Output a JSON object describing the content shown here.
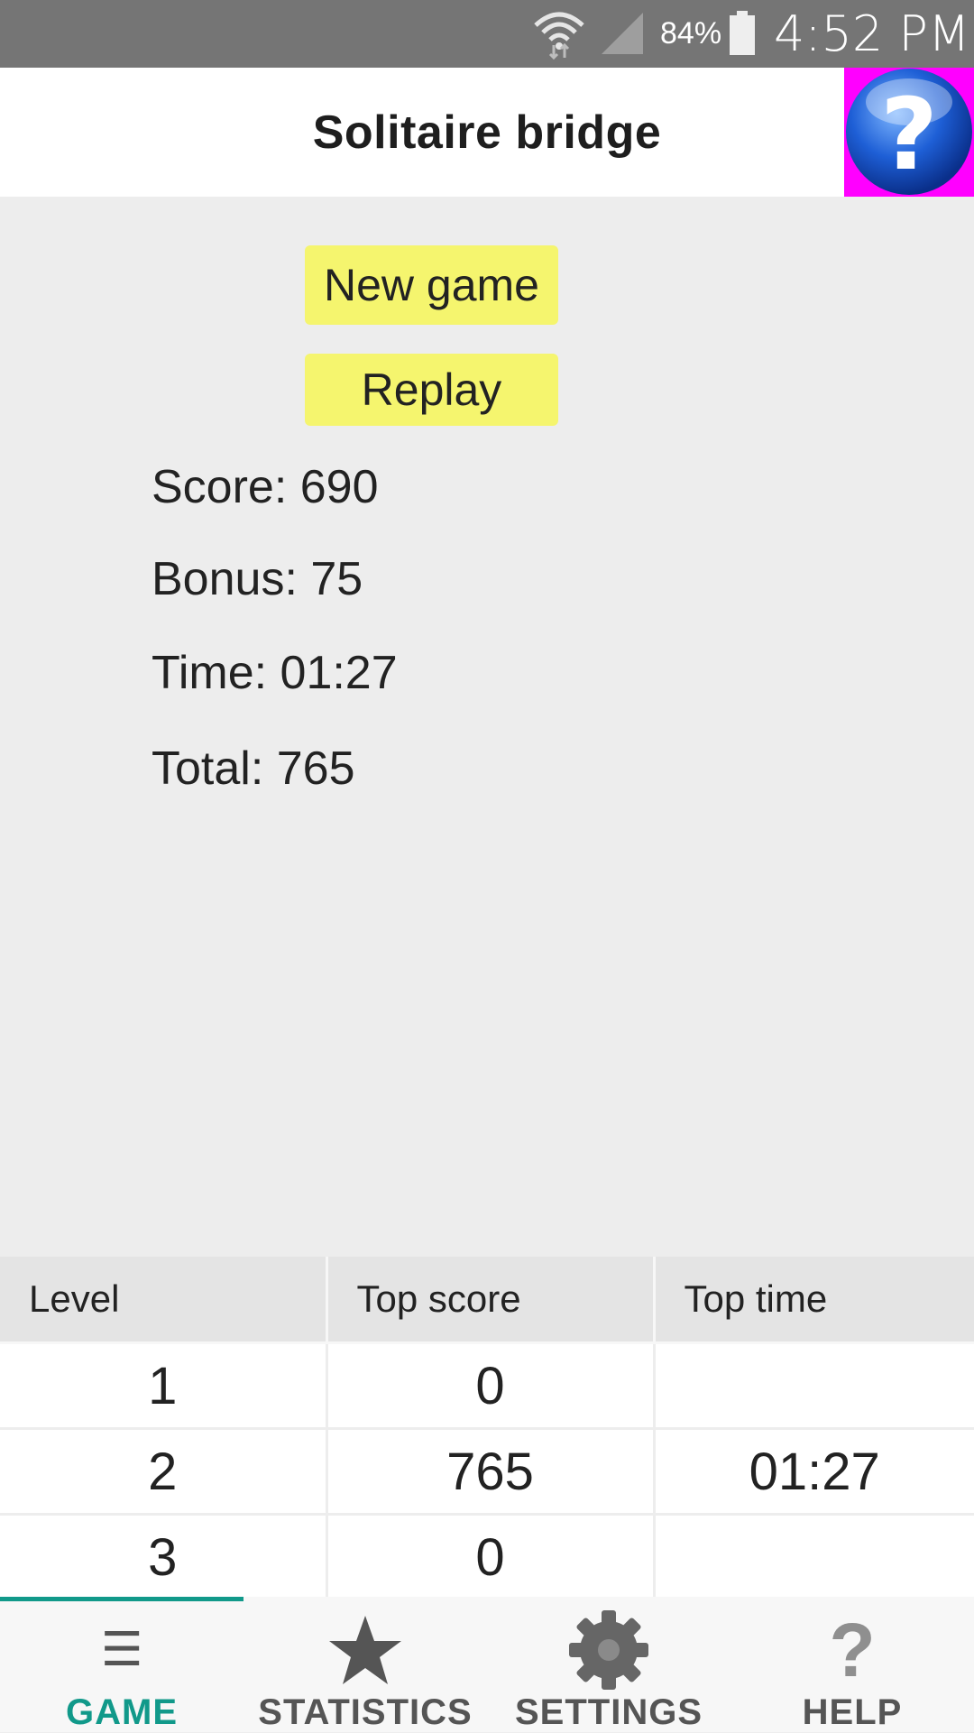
{
  "status_bar": {
    "battery_percent": "84%",
    "time": "4:52 PM"
  },
  "header": {
    "title": "Solitaire bridge",
    "help_icon": "question-icon",
    "help_icon_bg": "#ff00ff"
  },
  "actions": {
    "new_game_label": "New game",
    "replay_label": "Replay",
    "button_color": "#f5f56e"
  },
  "stats": {
    "score": "Score: 690",
    "bonus": "Bonus: 75",
    "time": "Time: 01:27",
    "total": "Total: 765"
  },
  "records": {
    "headers": [
      "Level",
      "Top score",
      "Top time"
    ],
    "rows": [
      [
        "1",
        "0",
        ""
      ],
      [
        "2",
        "765",
        "01:27"
      ],
      [
        "3",
        "0",
        ""
      ]
    ]
  },
  "bottom_nav": {
    "accent_color": "#11998a",
    "active": "GAME",
    "items": [
      {
        "label": "GAME",
        "icon": "menu-icon"
      },
      {
        "label": "STATISTICS",
        "icon": "star-icon"
      },
      {
        "label": "SETTINGS",
        "icon": "gear-icon"
      },
      {
        "label": "HELP",
        "icon": "question-icon"
      }
    ]
  }
}
